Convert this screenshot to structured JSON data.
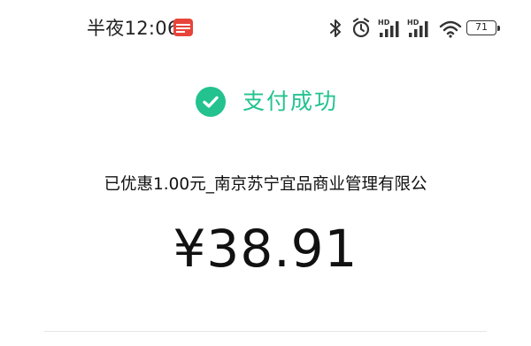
{
  "status_bar": {
    "time": "半夜12:06",
    "notification_icon": "app-notification-icon",
    "icons": [
      "bluetooth-icon",
      "alarm-icon",
      "hd-signal-icon",
      "hd-signal-icon",
      "wifi-icon"
    ],
    "battery_level": "71"
  },
  "payment": {
    "status_text": "支付成功",
    "status_color": "#23c28f",
    "merchant_line": "已优惠1.00元_南京苏宁宜品商业管理有限公",
    "amount": "¥38.91"
  }
}
